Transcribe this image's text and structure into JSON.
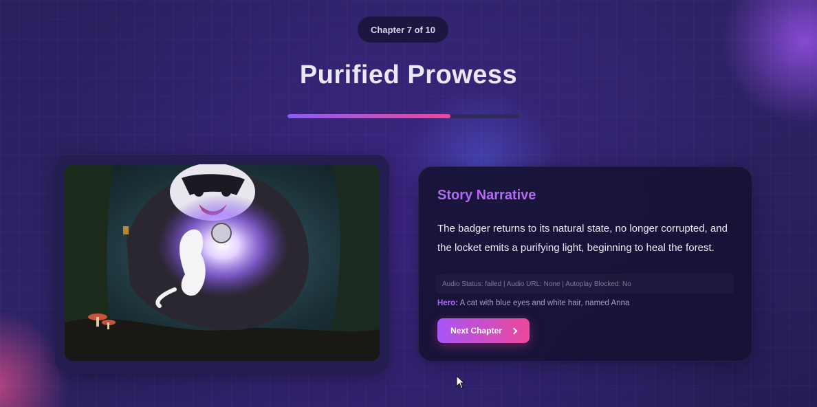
{
  "header": {
    "chapter_label": "Chapter 7 of 10",
    "title": "Purified Prowess",
    "progress": {
      "current": 7,
      "total": 10,
      "fraction": 0.7
    }
  },
  "image_card": {
    "icon": "story-illustration"
  },
  "narrative": {
    "heading": "Story Narrative",
    "text": "The badger returns to its natural state, no longer corrupted, and the locket emits a purifying light, beginning to heal the forest.",
    "audio_status": "Audio Status: failed | Audio URL: None | Autoplay Blocked: No",
    "hero_label": "Hero:",
    "hero_text": "A cat with blue eyes and white hair, named Anna",
    "next_button_label": "Next Chapter",
    "next_icon": "chevron-right-icon"
  },
  "colors": {
    "accent_purple": "#b469f2",
    "button_gradient_start": "#a855f7",
    "button_gradient_end": "#ec4899",
    "background": "#2a2060"
  },
  "cursor": {
    "icon": "cursor-icon"
  }
}
